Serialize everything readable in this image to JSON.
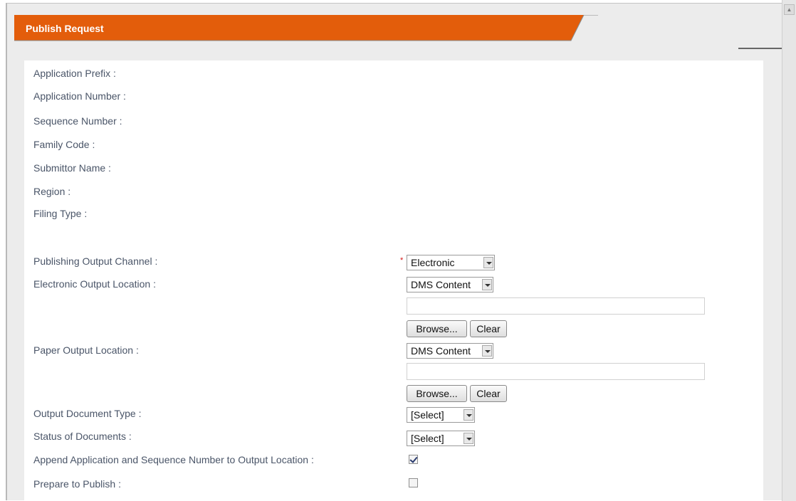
{
  "header": {
    "title": "Publish Request"
  },
  "fields": {
    "application_prefix": "Application Prefix :",
    "application_number": "Application Number :",
    "sequence_number": "Sequence Number :",
    "family_code": "Family Code :",
    "submittor_name": "Submittor Name :",
    "region": "Region :",
    "filing_type": "Filing Type :",
    "publishing_output_channel": "Publishing Output Channel :",
    "electronic_output_location": "Electronic Output Location :",
    "paper_output_location": "Paper Output Location :",
    "output_document_type": "Output Document Type :",
    "status_of_documents": "Status of Documents :",
    "append_app_seq": "Append Application and Sequence Number to Output Location :",
    "prepare_to_publish": "Prepare to Publish :"
  },
  "controls": {
    "required_marker": "*",
    "publishing_output_channel_value": "Electronic",
    "electronic_output_location_value": "DMS Content",
    "electronic_path_value": "",
    "paper_output_location_value": "DMS Content",
    "paper_path_value": "",
    "browse_label": "Browse...",
    "clear_label": "Clear",
    "output_document_type_value": "[Select]",
    "status_of_documents_value": "[Select]",
    "append_checked": true,
    "prepare_checked": false
  },
  "colors": {
    "header_orange": "#e35d0b",
    "label_text": "#4a5568",
    "required": "#d41414"
  }
}
